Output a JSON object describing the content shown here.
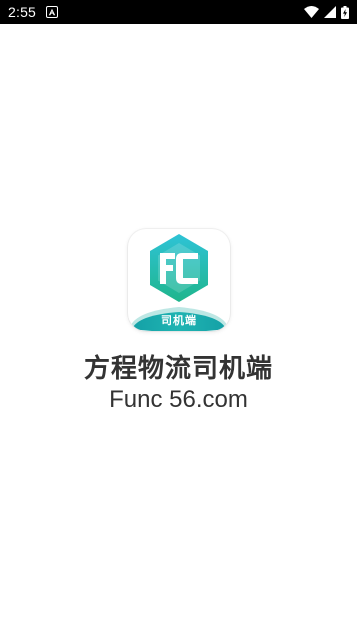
{
  "status_bar": {
    "time": "2:55",
    "notification_icon": "accessibility-icon",
    "wifi_icon": "wifi-icon",
    "signal_icon": "cell-signal-icon",
    "battery_icon": "battery-charging-icon"
  },
  "splash": {
    "app_icon": {
      "monogram": "FC",
      "ribbon_label": "司机端",
      "colors": {
        "hex_top": "#2ec3d6",
        "hex_bottom": "#1fb58c",
        "ribbon": "#1aa9ad",
        "letters": "#ffffff"
      }
    },
    "app_name": "方程物流司机端",
    "domain_text": "Func 56.com"
  }
}
